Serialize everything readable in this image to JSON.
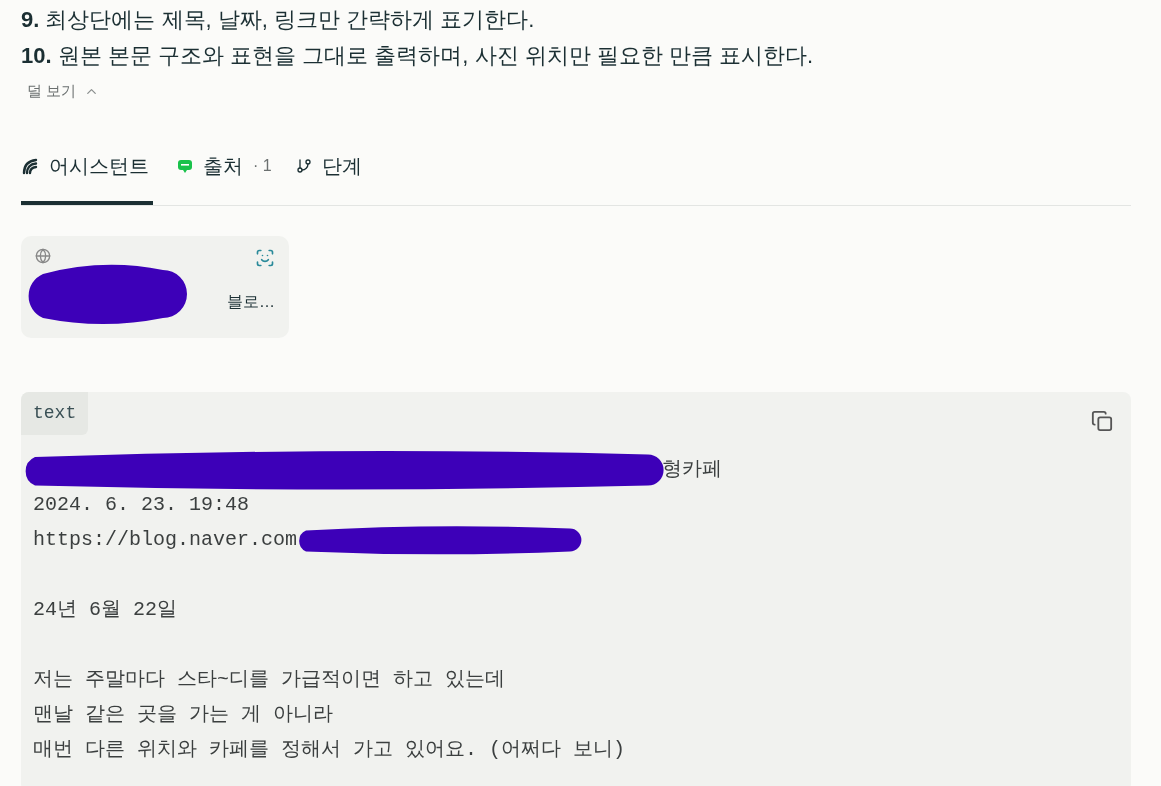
{
  "instructions": [
    {
      "number": "9.",
      "text": "최상단에는 제목, 날짜, 링크만 간략하게 표기한다."
    },
    {
      "number": "10.",
      "text": "원본 본문 구조와 표현을 그대로 출력하며, 사진 위치만 필요한 만큼 표시한다."
    }
  ],
  "collapse_link": "덜 보기",
  "tabs": [
    {
      "kind": "assistant",
      "label": "어시스턴트",
      "selected": true
    },
    {
      "kind": "sources",
      "label": "출처",
      "count": "· 1",
      "selected": false
    },
    {
      "kind": "steps",
      "label": "단계",
      "selected": false
    }
  ],
  "source_card": {
    "snippet": "블로…",
    "scribbled": true
  },
  "code_block": {
    "language": "text",
    "paragraphs": [
      [
        {
          "text": "형카페",
          "scribble_before": true
        },
        {
          "text": "2024. 6. 23. 19:48"
        },
        {
          "text": "https://blog.naver.com",
          "scribble_after": true
        }
      ],
      [
        {
          "text": "24년 6월 22일"
        }
      ],
      [
        {
          "text": "저는 주말마다 스타~디를 가급적이면 하고 있는데"
        },
        {
          "text": "맨날 같은 곳을 가는 게 아니라"
        },
        {
          "text": "매번 다른 위치와 카페를 정해서 가고 있어요. (어쩌다 보니)"
        }
      ]
    ]
  }
}
